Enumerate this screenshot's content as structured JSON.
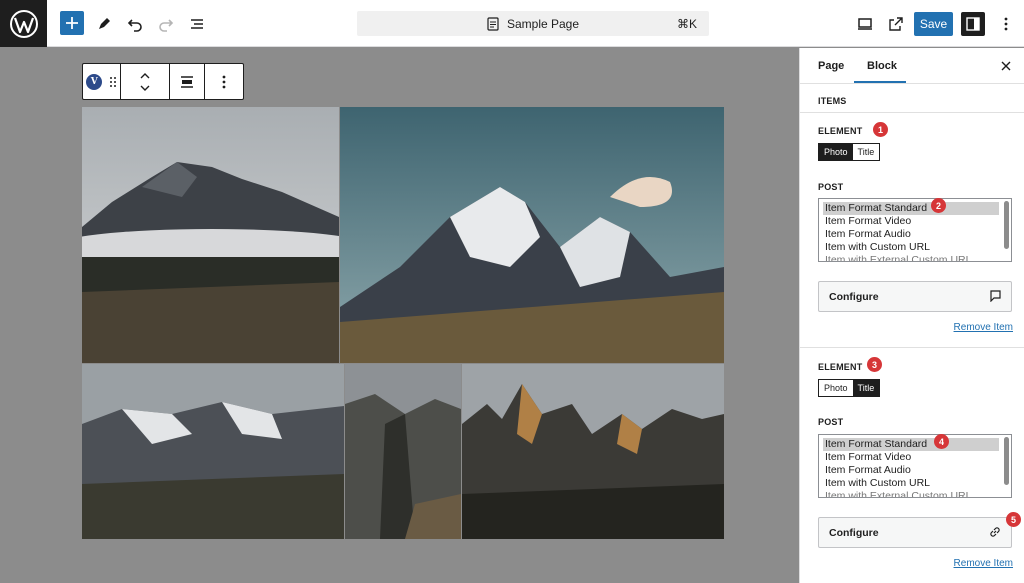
{
  "header": {
    "document_title": "Sample Page",
    "shortcut": "⌘K",
    "save_label": "Save",
    "icons": [
      "wordpress-logo",
      "plus-icon",
      "pen-icon",
      "undo-icon",
      "redo-icon",
      "list-view-icon",
      "document-icon",
      "desktop-icon",
      "external-link-icon",
      "sidebar-icon",
      "more-vertical-icon"
    ]
  },
  "block_toolbar": {
    "block_badge": "V",
    "icons": [
      "drag-handle-icon",
      "chevron-up-icon",
      "chevron-down-icon",
      "align-icon",
      "more-vertical-icon"
    ]
  },
  "sidebar": {
    "tabs": [
      {
        "label": "Page",
        "active": false
      },
      {
        "label": "Block",
        "active": true
      }
    ],
    "section_title": "ITEMS",
    "items": [
      {
        "element_label": "ELEMENT",
        "element_badge": "1",
        "element_options": [
          "Photo",
          "Title"
        ],
        "element_selected": "Photo",
        "post_label": "POST",
        "post_badge": "2",
        "post_options": [
          "Item Format Standard",
          "Item Format Video",
          "Item Format Audio",
          "Item with Custom URL",
          "Item with External Custom URL"
        ],
        "post_selected": "Item Format Standard",
        "configure_label": "Configure",
        "configure_icon": "comment-icon",
        "remove_label": "Remove Item"
      },
      {
        "element_label": "ELEMENT",
        "element_badge": "3",
        "element_options": [
          "Photo",
          "Title"
        ],
        "element_selected": "Title",
        "post_label": "POST",
        "post_badge": "4",
        "post_options": [
          "Item Format Standard",
          "Item Format Video",
          "Item Format Audio",
          "Item with Custom URL",
          "Item with External Custom URL"
        ],
        "post_selected": "Item Format Standard",
        "configure_label": "Configure",
        "configure_badge": "5",
        "configure_icon": "link-icon",
        "remove_label": "Remove Item"
      }
    ]
  },
  "colors": {
    "accent": "#2271b1",
    "badge_red": "#d63638",
    "dark": "#1e1e1e"
  }
}
